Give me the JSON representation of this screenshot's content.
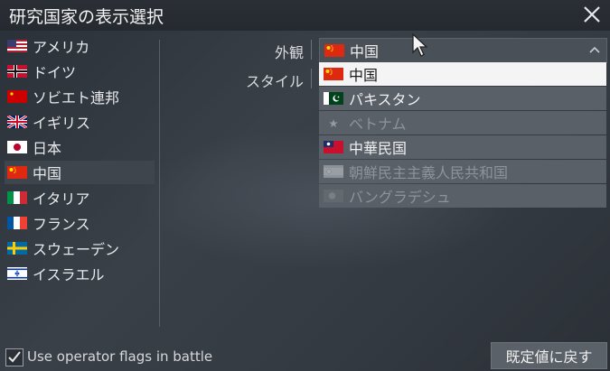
{
  "title": "研究国家の表示選択",
  "nations": [
    {
      "label": "アメリカ",
      "flag": "usa"
    },
    {
      "label": "ドイツ",
      "flag": "germany"
    },
    {
      "label": "ソビエト連邦",
      "flag": "ussr"
    },
    {
      "label": "イギリス",
      "flag": "uk"
    },
    {
      "label": "日本",
      "flag": "japan"
    },
    {
      "label": "中国",
      "flag": "china",
      "selected": true
    },
    {
      "label": "イタリア",
      "flag": "italy"
    },
    {
      "label": "フランス",
      "flag": "france"
    },
    {
      "label": "スウェーデン",
      "flag": "sweden"
    },
    {
      "label": "イスラエル",
      "flag": "israel"
    }
  ],
  "form": {
    "appearance_label": "外観",
    "style_label": "スタイル",
    "appearance_value": "中国"
  },
  "dropdown": {
    "options": [
      {
        "label": "中国",
        "flag": "china",
        "highlighted": true,
        "enabled": true
      },
      {
        "label": "パキスタン",
        "flag": "pakistan",
        "enabled": true
      },
      {
        "label": "ベトナム",
        "flag": "vietnam",
        "enabled": false
      },
      {
        "label": "中華民国",
        "flag": "roc",
        "enabled": true
      },
      {
        "label": "朝鮮民主主義人民共和国",
        "flag": "dprk",
        "enabled": false
      },
      {
        "label": "バングラデシュ",
        "flag": "bangladesh",
        "enabled": false
      }
    ]
  },
  "footer": {
    "checkbox_label": "Use operator flags in battle",
    "checkbox_checked": true,
    "reset_label": "既定値に戻す"
  },
  "icons": {
    "close": "close-icon",
    "dropdown_chevron": "chevron-up-icon",
    "checkbox_check": "checkmark-icon",
    "cursor": "mouse-cursor-icon"
  }
}
